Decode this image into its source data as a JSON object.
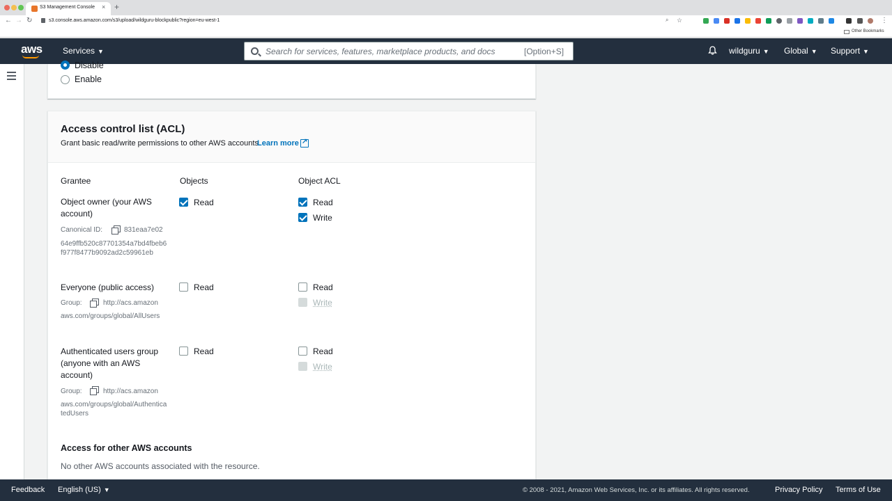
{
  "browser": {
    "tab_title": "S3 Management Console",
    "tab_close": "×",
    "new_tab": "+",
    "url": "s3.console.aws.amazon.com/s3/upload/wildguru-blockpublic?region=eu-west-1",
    "bookmarks_label": "Other Bookmarks"
  },
  "header": {
    "logo": "aws",
    "services_label": "Services",
    "search_placeholder": "Search for services, features, marketplace products, and docs",
    "search_shortcut": "[Option+S]",
    "account_label": "wildguru",
    "region_label": "Global",
    "support_label": "Support",
    "caret": "▼"
  },
  "encryption": {
    "options": [
      {
        "label": "Disable",
        "selected": true
      },
      {
        "label": "Enable",
        "selected": false
      }
    ]
  },
  "acl": {
    "title": "Access control list (ACL)",
    "description": "Grant basic read/write permissions to other AWS accounts.",
    "learn_more": "Learn more",
    "columns": {
      "grantee": "Grantee",
      "objects": "Objects",
      "object_acl": "Object ACL"
    },
    "rows": [
      {
        "grantee": "Object owner (your AWS account)",
        "meta_label": "Canonical ID:",
        "meta_value_first": "831eaa7e02",
        "meta_value_rest": "64e9ffb520c87701354a7bd4fbeb6f977f8477b9092ad2c59961eb",
        "objects_read": {
          "label": "Read",
          "checked": true
        },
        "acl_read": {
          "label": "Read",
          "checked": true
        },
        "acl_write": {
          "label": "Write",
          "checked": true,
          "disabled": false
        }
      },
      {
        "grantee": "Everyone (public access)",
        "meta_label": "Group:",
        "meta_value_first": "http://acs.amazon",
        "meta_value_rest": "aws.com/groups/global/AllUsers",
        "objects_read": {
          "label": "Read",
          "checked": false
        },
        "acl_read": {
          "label": "Read",
          "checked": false
        },
        "acl_write": {
          "label": "Write",
          "checked": false,
          "disabled": true
        }
      },
      {
        "grantee": "Authenticated users group (anyone with an AWS account)",
        "meta_label": "Group:",
        "meta_value_first": "http://acs.amazon",
        "meta_value_rest": "aws.com/groups/global/AuthenticatedUsers",
        "objects_read": {
          "label": "Read",
          "checked": false
        },
        "acl_read": {
          "label": "Read",
          "checked": false
        },
        "acl_write": {
          "label": "Write",
          "checked": false,
          "disabled": true
        }
      }
    ],
    "other_accounts_title": "Access for other AWS accounts",
    "other_accounts_desc": "No other AWS accounts associated with the resource."
  },
  "footer": {
    "feedback": "Feedback",
    "language": "English (US)",
    "copyright": "© 2008 - 2021, Amazon Web Services, Inc. or its affiliates. All rights reserved.",
    "privacy": "Privacy Policy",
    "terms": "Terms of Use"
  },
  "colors": {
    "header_bg": "#232f3e",
    "accent": "#0073bb",
    "aws_orange": "#ff9900"
  }
}
